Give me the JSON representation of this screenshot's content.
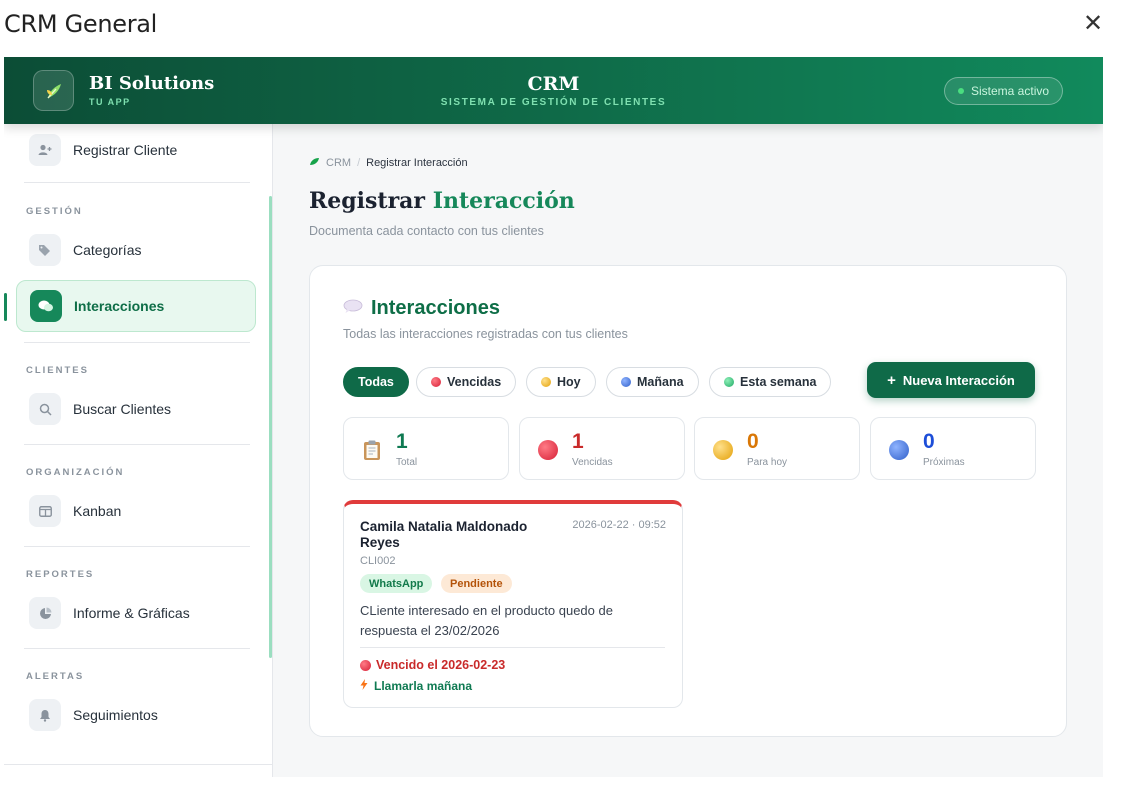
{
  "window": {
    "title": "CRM General",
    "close_icon": "close-icon"
  },
  "header": {
    "brand": "BI Solutions",
    "brand_sub": "TU APP",
    "title": "CRM",
    "subtitle": "SISTEMA DE GESTIÓN DE CLIENTES",
    "status": "Sistema activo",
    "colors": {
      "gradient_start": "#0c4d36",
      "gradient_end": "#118a5c",
      "status_dot": "#4ade80"
    }
  },
  "sidebar": {
    "top_item": {
      "label": "Registrar Cliente",
      "icon": "add-user-icon"
    },
    "sections": [
      {
        "title": "GESTIÓN",
        "items": [
          {
            "label": "Categorías",
            "icon": "tags-icon"
          },
          {
            "label": "Interacciones",
            "icon": "chat-icon",
            "active": true
          }
        ]
      },
      {
        "title": "CLIENTES",
        "items": [
          {
            "label": "Buscar Clientes",
            "icon": "search-icon"
          }
        ]
      },
      {
        "title": "ORGANIZACIÓN",
        "items": [
          {
            "label": "Kanban",
            "icon": "kanban-icon"
          }
        ]
      },
      {
        "title": "REPORTES",
        "items": [
          {
            "label": "Informe & Gráficas",
            "icon": "pie-chart-icon"
          }
        ]
      },
      {
        "title": "ALERTAS",
        "items": [
          {
            "label": "Seguimientos",
            "icon": "bell-icon"
          }
        ]
      }
    ]
  },
  "breadcrumb": {
    "root": "CRM",
    "separator": "/",
    "current": "Registrar Interacción"
  },
  "page": {
    "title_main": "Registrar",
    "title_accent": "Interacción",
    "subtitle": "Documenta cada contacto con tus clientes"
  },
  "panel": {
    "title": "Interacciones",
    "subtitle": "Todas las interacciones registradas con tus clientes",
    "filters": [
      {
        "label": "Todas",
        "active": true
      },
      {
        "label": "Vencidas",
        "color": "#e0334a"
      },
      {
        "label": "Hoy",
        "color": "#f0b429"
      },
      {
        "label": "Mañana",
        "color": "#3b6fd6"
      },
      {
        "label": "Esta semana",
        "color": "#22b573"
      }
    ],
    "new_button": "Nueva Interacción",
    "stats": [
      {
        "value": "1",
        "label": "Total",
        "color": "#0f7a52",
        "icon": "clipboard-icon"
      },
      {
        "value": "1",
        "label": "Vencidas",
        "color": "#c92a2a",
        "icon": "red-circle-icon"
      },
      {
        "value": "0",
        "label": "Para hoy",
        "color": "#d97706",
        "icon": "yellow-circle-icon"
      },
      {
        "value": "0",
        "label": "Próximas",
        "color": "#1d4ed8",
        "icon": "blue-circle-icon"
      }
    ],
    "interactions": [
      {
        "name": "Camila Natalia Maldonado Reyes",
        "datetime": "2026-02-22 · 09:52",
        "code": "CLI002",
        "channel": "WhatsApp",
        "status": "Pendiente",
        "description": "CLiente interesado en el producto quedo de respuesta el 23/02/2026",
        "due": "Vencido el 2026-02-23",
        "next_action": "Llamarla mañana"
      }
    ]
  }
}
